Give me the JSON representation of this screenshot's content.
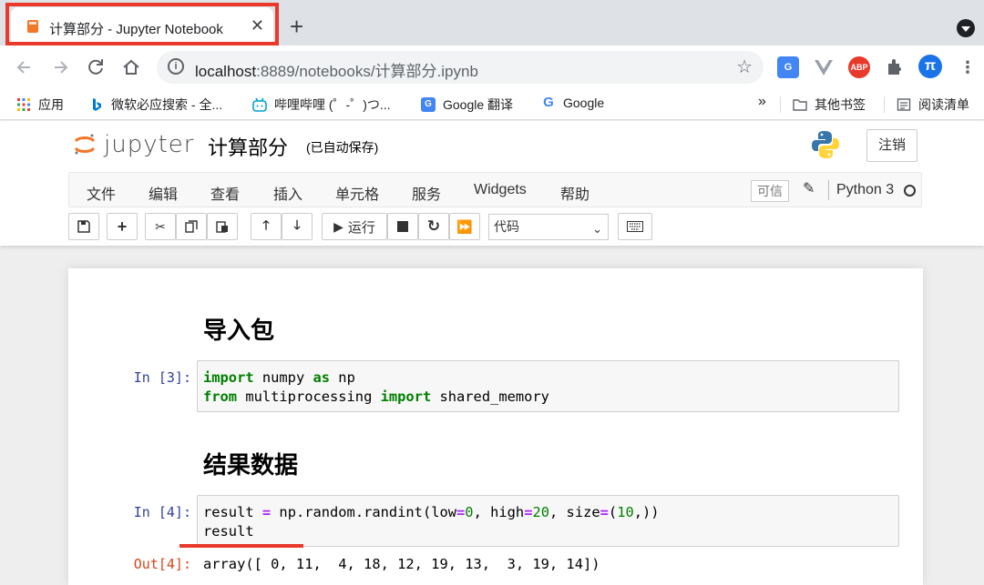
{
  "browser": {
    "tab_title": "计算部分 - Jupyter Notebook",
    "tab_close": "✕",
    "new_tab": "+",
    "url_host": "localhost",
    "url_rest": ":8889/notebooks/计算部分.ipynb",
    "icons": [
      "back-icon",
      "forward-icon",
      "reload-icon",
      "home-icon",
      "info-icon",
      "star-icon",
      "translate-icon",
      "vue-icon",
      "adblock-icon",
      "puzzle-icon",
      "profile-icon",
      "menu-icon"
    ],
    "profile_letter": "π",
    "adblock_label": "ABP",
    "bookmarks": [
      {
        "label": "应用"
      },
      {
        "label": "微软必应搜索 - 全..."
      },
      {
        "label": "哔哩哔哩 (゜-゜)つ..."
      },
      {
        "label": "Google 翻译"
      },
      {
        "label": "Google"
      }
    ],
    "bookmarks_more": "»",
    "other_bookmarks": "其他书签",
    "reading_list": "阅读清单"
  },
  "jupyter": {
    "logo_text": "jupyter",
    "notebook_name": "计算部分",
    "autosave": "(已自动保存)",
    "logout": "注销",
    "menu": [
      "文件",
      "编辑",
      "查看",
      "插入",
      "单元格",
      "服务",
      "Widgets",
      "帮助"
    ],
    "trusted": "可信",
    "kernel_name": "Python 3",
    "run_label": "运行",
    "cell_type": "代码"
  },
  "cells": {
    "h1": "导入包",
    "h2": "结果数据",
    "in3_prompt": "In [3]:",
    "in4_prompt": "In [4]:",
    "out4_prompt": "Out[4]:",
    "out4_text": "array([ 0, 11,  4, 18, 12, 19, 13,  3, 19, 14])"
  },
  "colors": {
    "highlight": "#e8392b",
    "prompt_in": "#303f9f",
    "prompt_out": "#d84315",
    "keyword": "#008000"
  }
}
